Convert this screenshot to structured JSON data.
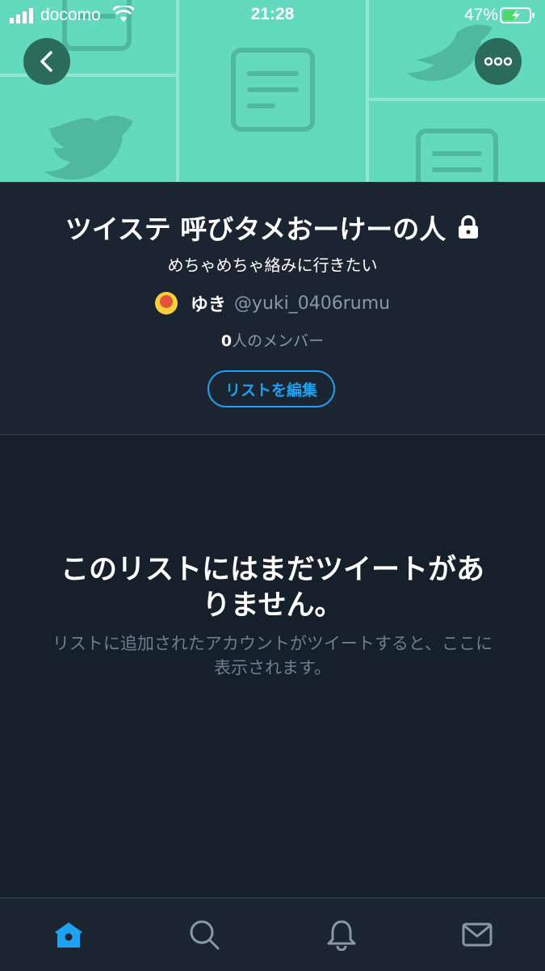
{
  "status_bar": {
    "carrier": "docomo",
    "time": "21:28",
    "battery": "47%"
  },
  "list": {
    "title": "ツイステ 呼びタメおーけーの人",
    "description": "めちゃめちゃ絡みに行きたい",
    "owner_name": "ゆき",
    "owner_handle": "@yuki_0406rumu",
    "member_count": "0",
    "member_suffix": "人のメンバー",
    "edit_button": "リストを編集"
  },
  "empty_state": {
    "title": "このリストにはまだツイートがありません。",
    "subtitle": "リストに追加されたアカウントがツイートすると、ここに表示されます。"
  },
  "tabs": [
    {
      "icon": "home-icon",
      "active": true
    },
    {
      "icon": "search-icon",
      "active": false
    },
    {
      "icon": "bell-icon",
      "active": false
    },
    {
      "icon": "mail-icon",
      "active": false
    }
  ],
  "colors": {
    "banner": "#63d9bd",
    "accent": "#1da1f2",
    "background": "#15202b",
    "panel": "#1b2431"
  }
}
